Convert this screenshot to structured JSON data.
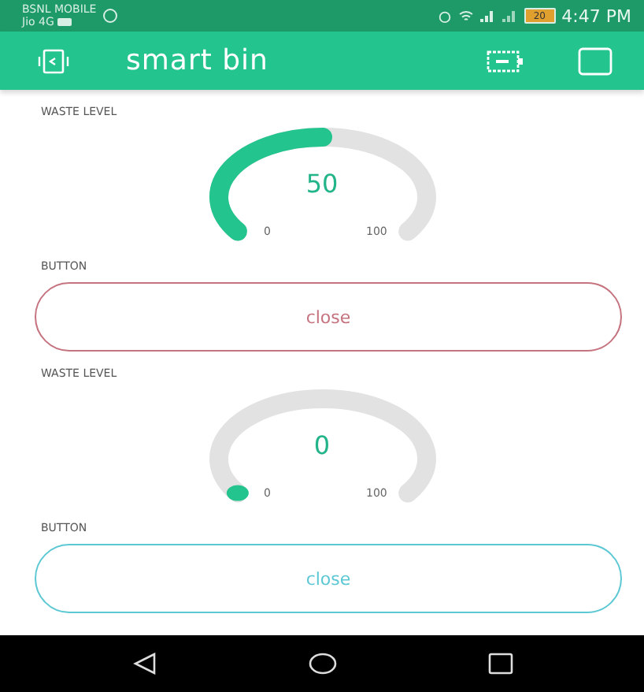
{
  "status_bar": {
    "carrier_1": "BSNL MOBILE",
    "carrier_2": "Jio 4G",
    "battery": "20",
    "time": "4:47 PM"
  },
  "app_bar": {
    "title": "smart bin"
  },
  "widgets": [
    {
      "kind": "gauge",
      "label": "WASTE LEVEL",
      "value": "50",
      "min": "0",
      "max": "100"
    },
    {
      "kind": "button",
      "label": "BUTTON",
      "text": "close",
      "color": "#c4737f"
    },
    {
      "kind": "gauge",
      "label": "WASTE LEVEL",
      "value": "0",
      "min": "0",
      "max": "100"
    },
    {
      "kind": "button",
      "label": "BUTTON",
      "text": "close",
      "color": "#5cc8d4"
    }
  ]
}
